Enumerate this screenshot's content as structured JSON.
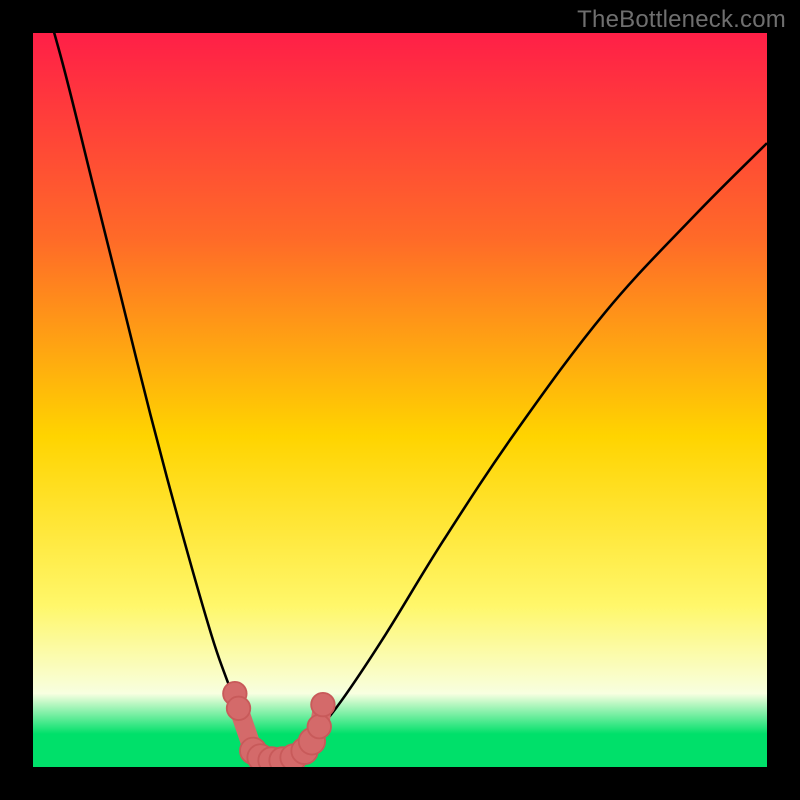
{
  "watermark": "TheBottleneck.com",
  "colors": {
    "bg": "#000000",
    "grad_top": "#ff1f47",
    "grad_upper": "#ff6a28",
    "grad_mid": "#ffd400",
    "grad_lower": "#fff76a",
    "grad_pale": "#f8ffe0",
    "grad_green": "#00e06a",
    "curve": "#000000",
    "marker_fill": "#d46a6a",
    "marker_stroke": "#c85a5a"
  },
  "chart_data": {
    "type": "line",
    "title": "",
    "xlabel": "",
    "ylabel": "",
    "xlim": [
      0,
      100
    ],
    "ylim": [
      0,
      100
    ],
    "series": [
      {
        "name": "bottleneck-curve",
        "x": [
          0,
          4,
          8,
          12,
          16,
          20,
          24,
          26,
          28,
          30,
          31,
          32,
          33,
          34,
          35,
          36,
          38,
          42,
          48,
          56,
          66,
          78,
          90,
          100
        ],
        "y": [
          110,
          96,
          80,
          64,
          48,
          33,
          19,
          13,
          8,
          4,
          2,
          1,
          0.5,
          0.5,
          1,
          2,
          4,
          9,
          18,
          31,
          46,
          62,
          75,
          85
        ]
      }
    ],
    "markers": [
      {
        "x": 27.5,
        "y": 10.0,
        "r": 1.6
      },
      {
        "x": 28.0,
        "y": 8.0,
        "r": 1.6
      },
      {
        "x": 30.0,
        "y": 2.2,
        "r": 1.8
      },
      {
        "x": 31.0,
        "y": 1.3,
        "r": 1.8
      },
      {
        "x": 32.5,
        "y": 0.9,
        "r": 1.8
      },
      {
        "x": 34.0,
        "y": 0.9,
        "r": 1.8
      },
      {
        "x": 35.5,
        "y": 1.3,
        "r": 1.8
      },
      {
        "x": 37.0,
        "y": 2.2,
        "r": 1.8
      },
      {
        "x": 38.0,
        "y": 3.5,
        "r": 1.8
      },
      {
        "x": 39.0,
        "y": 5.5,
        "r": 1.6
      },
      {
        "x": 39.5,
        "y": 8.5,
        "r": 1.6
      }
    ],
    "gradient_stops": [
      {
        "offset": 0.0,
        "key": "grad_top"
      },
      {
        "offset": 0.28,
        "key": "grad_upper"
      },
      {
        "offset": 0.55,
        "key": "grad_mid"
      },
      {
        "offset": 0.78,
        "key": "grad_lower"
      },
      {
        "offset": 0.9,
        "key": "grad_pale"
      },
      {
        "offset": 0.955,
        "key": "grad_green"
      },
      {
        "offset": 1.0,
        "key": "grad_green"
      }
    ]
  }
}
